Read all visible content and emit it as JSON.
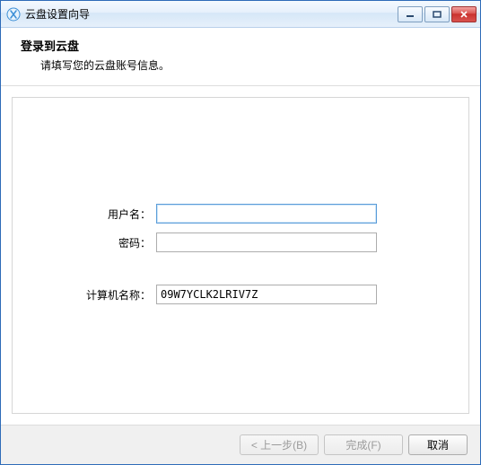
{
  "window": {
    "title": "云盘设置向导"
  },
  "header": {
    "title": "登录到云盘",
    "subtitle": "请填写您的云盘账号信息。"
  },
  "form": {
    "username_label": "用户名：",
    "username_value": "",
    "password_label": "密码：",
    "password_value": "",
    "computer_label": "计算机名称：",
    "computer_value": "09W7YCLK2LRIV7Z"
  },
  "footer": {
    "back_label": "< 上一步(B)",
    "finish_label": "完成(F)",
    "cancel_label": "取消"
  },
  "icons": {
    "app": "cloud-setup-icon",
    "minimize": "minimize-icon",
    "maximize": "maximize-icon",
    "close": "close-icon"
  }
}
